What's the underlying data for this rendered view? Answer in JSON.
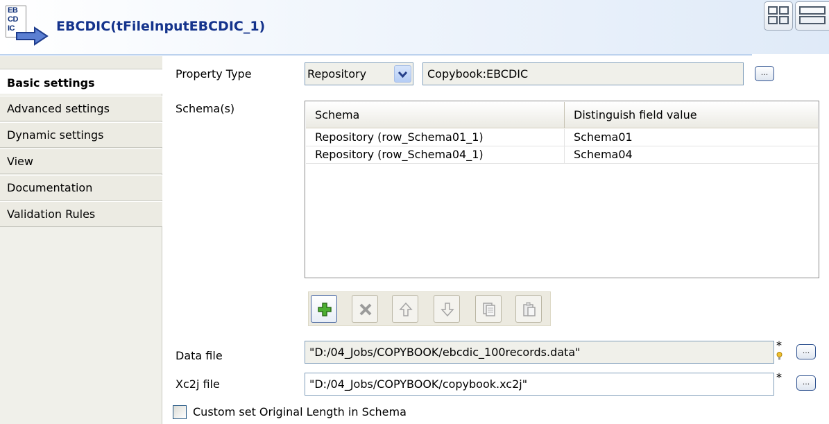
{
  "header": {
    "icon_text": [
      "EB",
      "CD",
      "IC"
    ],
    "title": "EBCDIC(tFileInputEBCDIC_1)"
  },
  "sidebar": {
    "items": [
      {
        "label": "Basic settings",
        "active": true
      },
      {
        "label": "Advanced settings",
        "active": false
      },
      {
        "label": "Dynamic settings",
        "active": false
      },
      {
        "label": "View",
        "active": false
      },
      {
        "label": "Documentation",
        "active": false
      },
      {
        "label": "Validation Rules",
        "active": false
      }
    ]
  },
  "form": {
    "property_type_label": "Property Type",
    "property_type_value": "Repository",
    "property_repo_value": "Copybook:EBCDIC",
    "schemas_label": "Schema(s)",
    "schema_table": {
      "headers": [
        "Schema",
        "Distinguish field value"
      ],
      "rows": [
        [
          "Repository (row_Schema01_1)",
          "Schema01"
        ],
        [
          "Repository (row_Schema04_1)",
          "Schema04"
        ]
      ]
    },
    "data_file_label": "Data file",
    "data_file_value": "\"D:/04_Jobs/COPYBOOK/ebcdic_100records.data\"",
    "xc2j_file_label": "Xc2j file",
    "xc2j_file_value": "\"D:/04_Jobs/COPYBOOK/copybook.xc2j\"",
    "required_marker": "*",
    "custom_length_label": "Custom set Original Length in Schema",
    "custom_length_checked": false,
    "browse_label": "..."
  },
  "toolbar": {
    "buttons": [
      {
        "icon": "add-icon",
        "enabled": true
      },
      {
        "icon": "delete-icon",
        "enabled": false
      },
      {
        "icon": "move-up-icon",
        "enabled": false
      },
      {
        "icon": "move-down-icon",
        "enabled": false
      },
      {
        "icon": "copy-icon",
        "enabled": false
      },
      {
        "icon": "paste-icon",
        "enabled": false
      }
    ]
  },
  "colors": {
    "title": "#14338c",
    "sidebar_bg": "#f0f0ea",
    "add_icon": "#3c9a2a"
  }
}
